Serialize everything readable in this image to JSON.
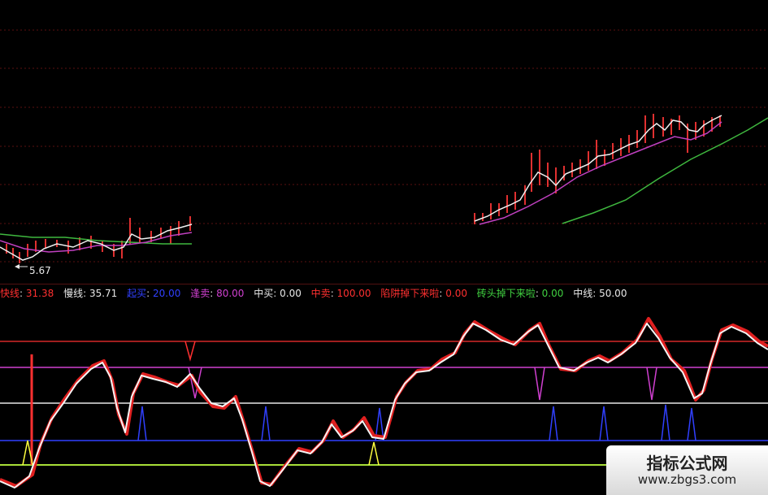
{
  "price_chart": {
    "low_label": "5.67",
    "colors": {
      "white_line": "#f0f0f0",
      "magenta_line": "#c040c0",
      "green_line": "#3fb83f",
      "candle_up": "#e03030"
    }
  },
  "indicator_legend": [
    {
      "label": "快线",
      "value": "31.38",
      "label_color": "#ff3030",
      "value_color": "#ff3030"
    },
    {
      "label": "慢线",
      "value": "35.71",
      "label_color": "#e8e8e8",
      "value_color": "#e8e8e8"
    },
    {
      "label": "起买",
      "value": "20.00",
      "label_color": "#3040ff",
      "value_color": "#3040ff"
    },
    {
      "label": "逢卖",
      "value": "80.00",
      "label_color": "#d040d0",
      "value_color": "#d040d0"
    },
    {
      "label": "中买",
      "value": "0.00",
      "label_color": "#e8e8e8",
      "value_color": "#e8e8e8"
    },
    {
      "label": "中卖",
      "value": "100.00",
      "label_color": "#ff3030",
      "value_color": "#ff3030"
    },
    {
      "label": "陷阱掉下来啦",
      "value": "0.00",
      "label_color": "#ff3030",
      "value_color": "#ff3030"
    },
    {
      "label": "砖头掉下来啦",
      "value": "0.00",
      "label_color": "#40d040",
      "value_color": "#40d040"
    },
    {
      "label": "中线",
      "value": "50.00",
      "label_color": "#e8e8e8",
      "value_color": "#e8e8e8"
    }
  ],
  "indicator_levels": {
    "sell_line": {
      "value": 80,
      "color": "#d040d0"
    },
    "mid_line": {
      "value": 50,
      "color": "#e8e8e8"
    },
    "buy_line": {
      "value": 20,
      "color": "#3040ff"
    },
    "zero_line": {
      "value": 0,
      "color": "#c0ff40"
    },
    "top_line": {
      "value": 100,
      "color": "#ff3030"
    }
  },
  "watermark": {
    "title": "指标公式网",
    "url": "www.zbgs3.com"
  }
}
